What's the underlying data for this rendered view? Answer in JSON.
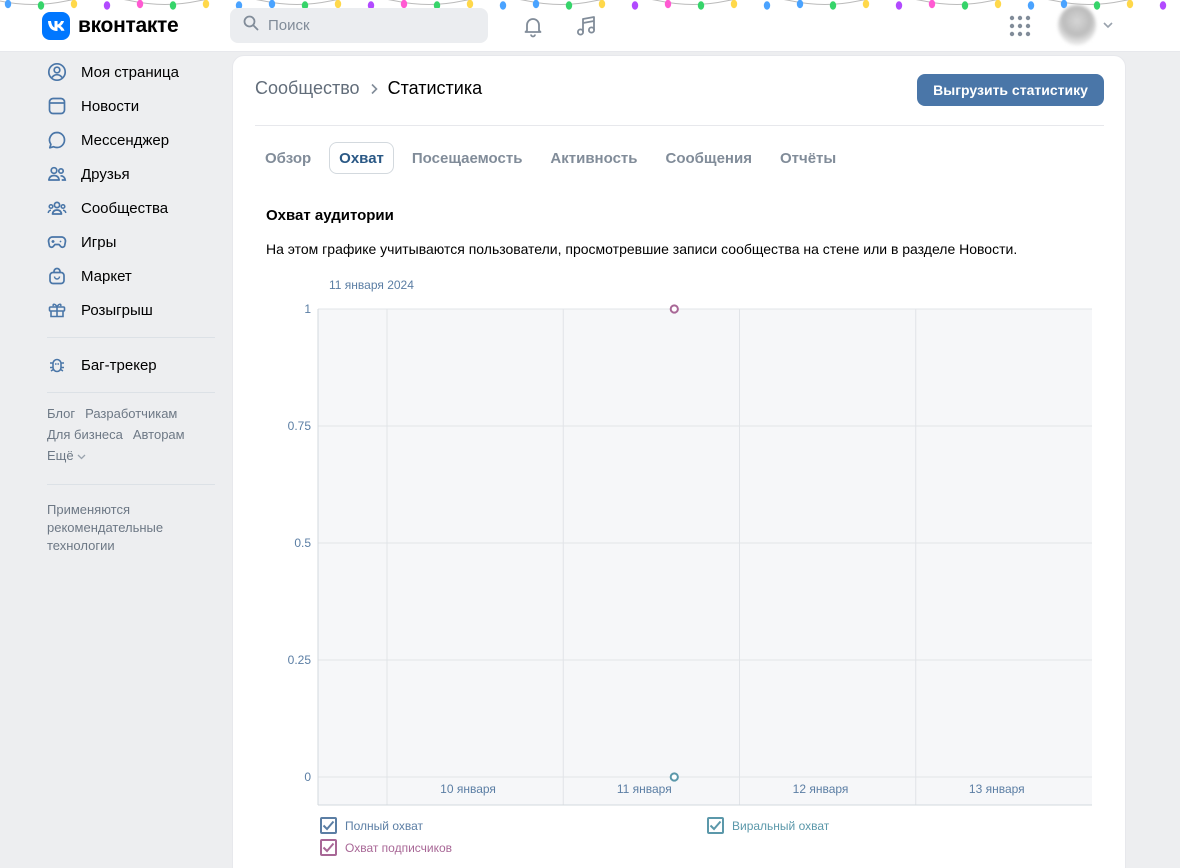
{
  "header": {
    "logo_text": "вконтакте",
    "search_placeholder": "Поиск",
    "icons": {
      "bell": "bell-icon",
      "music": "music-icon",
      "apps": "apps-grid-icon",
      "avatar_menu": "chevron-down-icon"
    }
  },
  "sidebar": {
    "items": [
      {
        "label": "Моя страница",
        "icon": "user-circle-icon"
      },
      {
        "label": "Новости",
        "icon": "newsfeed-icon"
      },
      {
        "label": "Мессенджер",
        "icon": "message-icon"
      },
      {
        "label": "Друзья",
        "icon": "friends-icon"
      },
      {
        "label": "Сообщества",
        "icon": "communities-icon"
      },
      {
        "label": "Игры",
        "icon": "gamepad-icon"
      },
      {
        "label": "Маркет",
        "icon": "market-bag-icon"
      },
      {
        "label": "Розыгрыш",
        "icon": "gift-icon"
      }
    ],
    "bugtracker": {
      "label": "Баг-трекер",
      "icon": "bug-icon"
    },
    "footer_links": [
      "Блог",
      "Разработчикам",
      "Для бизнеса",
      "Авторам",
      "Ещё"
    ],
    "note": "Применяются рекомендательные технологии"
  },
  "main": {
    "breadcrumb": {
      "parent": "Сообщество",
      "current": "Статистика"
    },
    "export_button": "Выгрузить статистику",
    "tabs": [
      {
        "label": "Обзор",
        "active": false
      },
      {
        "label": "Охват",
        "active": true
      },
      {
        "label": "Посещаемость",
        "active": false
      },
      {
        "label": "Активность",
        "active": false
      },
      {
        "label": "Сообщения",
        "active": false
      },
      {
        "label": "Отчёты",
        "active": false
      }
    ],
    "section_title": "Охват аудитории",
    "section_description": "На этом графике учитываются пользователи, просмотревшие записи сообщества на стене или в разделе Новости."
  },
  "chart_data": {
    "type": "line",
    "tooltip_date": "11 января 2024",
    "x": [
      "10 января",
      "11 января",
      "12 января",
      "13 января"
    ],
    "y_ticks": [
      "0",
      "0.25",
      "0.5",
      "0.75",
      "1"
    ],
    "ylim": [
      0,
      1
    ],
    "grid": true,
    "series": [
      {
        "name": "Полный охват",
        "color": "#5b7ea4",
        "checked": true,
        "points": []
      },
      {
        "name": "Виральный охват",
        "color": "#5b98aa",
        "checked": true,
        "points": [
          {
            "x": "11 января",
            "y": 0
          }
        ]
      },
      {
        "name": "Охват подписчиков",
        "color": "#a86796",
        "checked": true,
        "points": [
          {
            "x": "11 января",
            "y": 1
          }
        ]
      }
    ]
  },
  "colors": {
    "accent": "#4a76a8",
    "vk_blue": "#0077ff",
    "link": "#2a5885"
  }
}
